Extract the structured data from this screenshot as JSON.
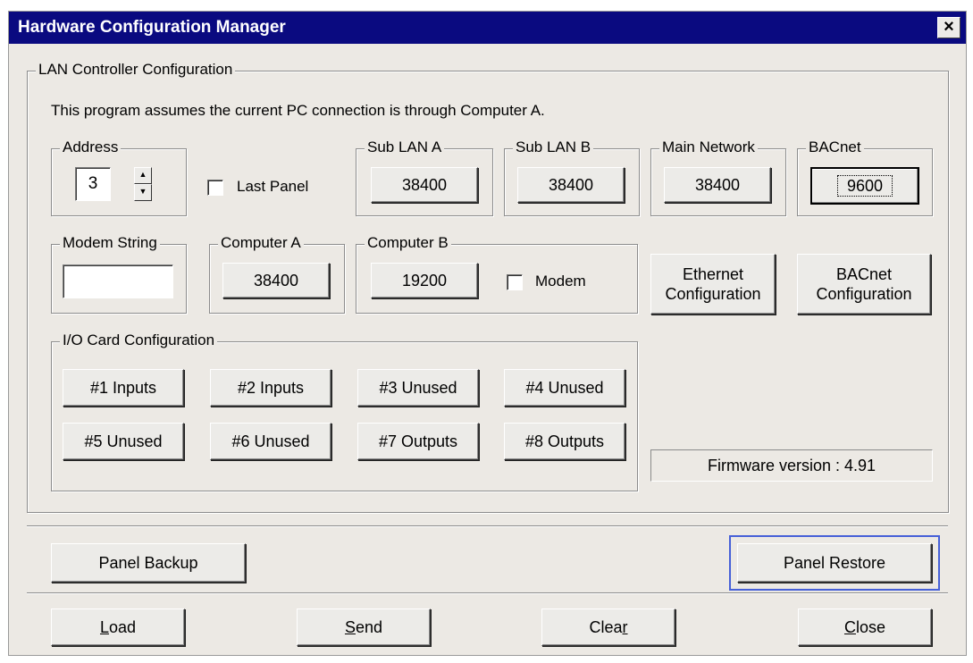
{
  "window": {
    "title": "Hardware Configuration Manager",
    "close_glyph": "×"
  },
  "lan": {
    "legend": "LAN Controller Configuration",
    "info": "This program assumes the current PC connection is through Computer A.",
    "address": {
      "legend": "Address",
      "value": "3"
    },
    "last_panel_label": "Last Panel",
    "sub_lan_a": {
      "legend": "Sub LAN A",
      "value": "38400"
    },
    "sub_lan_b": {
      "legend": "Sub LAN B",
      "value": "38400"
    },
    "main_network": {
      "legend": "Main Network",
      "value": "38400"
    },
    "bacnet": {
      "legend": "BACnet",
      "value": "9600"
    },
    "modem_string": {
      "legend": "Modem String",
      "value": ""
    },
    "computer_a": {
      "legend": "Computer A",
      "value": "38400"
    },
    "computer_b": {
      "legend": "Computer B",
      "value": "19200"
    },
    "modem_label": "Modem",
    "ethernet_config": [
      "Ethernet",
      "Configuration"
    ],
    "bacnet_config": [
      "BACnet",
      "Configuration"
    ],
    "io": {
      "legend": "I/O Card Configuration",
      "cards": [
        "#1 Inputs",
        "#2 Inputs",
        "#3 Unused",
        "#4 Unused",
        "#5 Unused",
        "#6 Unused",
        "#7 Outputs",
        "#8 Outputs"
      ]
    },
    "firmware": "Firmware version : 4.91"
  },
  "panel": {
    "backup": "Panel Backup",
    "restore": "Panel Restore"
  },
  "actions": {
    "load": {
      "pre": "",
      "key": "L",
      "post": "oad"
    },
    "send": {
      "pre": "",
      "key": "S",
      "post": "end"
    },
    "clear": {
      "pre": "Clea",
      "key": "r",
      "post": ""
    },
    "close": {
      "pre": "",
      "key": "C",
      "post": "lose"
    }
  },
  "icons": {
    "spin_up": "up-arrow-icon",
    "spin_down": "down-arrow-icon",
    "close": "close-icon"
  }
}
